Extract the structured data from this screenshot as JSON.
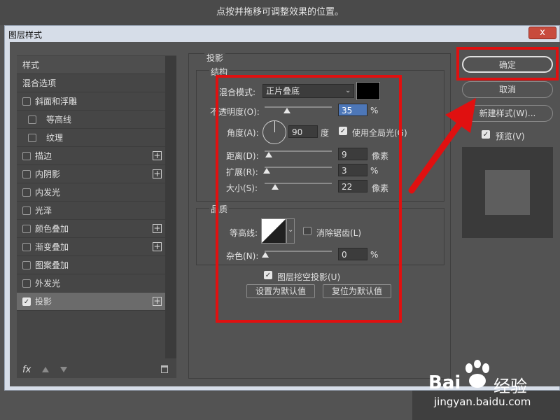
{
  "hint": "点按并拖移可调整效果的位置。",
  "dialog": {
    "title": "图层样式",
    "close": "x"
  },
  "styles_list": {
    "header": "样式",
    "blend_options": "混合选项",
    "items": [
      {
        "label": "斜面和浮雕",
        "checked": false
      },
      {
        "label": "等高线",
        "checked": false
      },
      {
        "label": "纹理",
        "checked": false
      },
      {
        "label": "描边",
        "checked": false
      },
      {
        "label": "内阴影",
        "checked": false
      },
      {
        "label": "内发光",
        "checked": false
      },
      {
        "label": "光泽",
        "checked": false
      },
      {
        "label": "颜色叠加",
        "checked": false
      },
      {
        "label": "渐变叠加",
        "checked": false
      },
      {
        "label": "图案叠加",
        "checked": false
      },
      {
        "label": "外发光",
        "checked": false
      },
      {
        "label": "投影",
        "checked": true
      }
    ],
    "plus": "+",
    "fx": "fx"
  },
  "shadow": {
    "title": "投影",
    "structure": "结构",
    "blend_mode_label": "混合模式:",
    "blend_mode_value": "正片叠底",
    "opacity_label": "不透明度(O):",
    "opacity_value": "35",
    "percent": "%",
    "angle_label": "角度(A):",
    "angle_value": "90",
    "degree": "度",
    "global_light_label": "使用全局光(G)",
    "distance_label": "距离(D):",
    "distance_value": "9",
    "pixels": "像素",
    "spread_label": "扩展(R):",
    "spread_value": "3",
    "size_label": "大小(S):",
    "size_value": "22",
    "quality": "品质",
    "contour_label": "等高线:",
    "antialias_label": "消除锯齿(L)",
    "noise_label": "杂色(N):",
    "noise_value": "0",
    "knockout_label": "图层挖空投影(U)",
    "set_default": "设置为默认值",
    "reset_default": "复位为默认值",
    "levels": {
      "opacity": 0.35,
      "distance": 0.09,
      "spread": 0.03,
      "size": 0.22,
      "noise": 0
    }
  },
  "right": {
    "ok": "确定",
    "cancel": "取消",
    "new_style": "新建样式(W)...",
    "preview": "预览(V)"
  },
  "watermark": {
    "brand": "Bai",
    "brand2": "经验",
    "url": "jingyan.baidu.com"
  },
  "colors": {
    "accent": "#4d77b8",
    "highlight": "#e01010",
    "shadow_color": "#000000"
  }
}
